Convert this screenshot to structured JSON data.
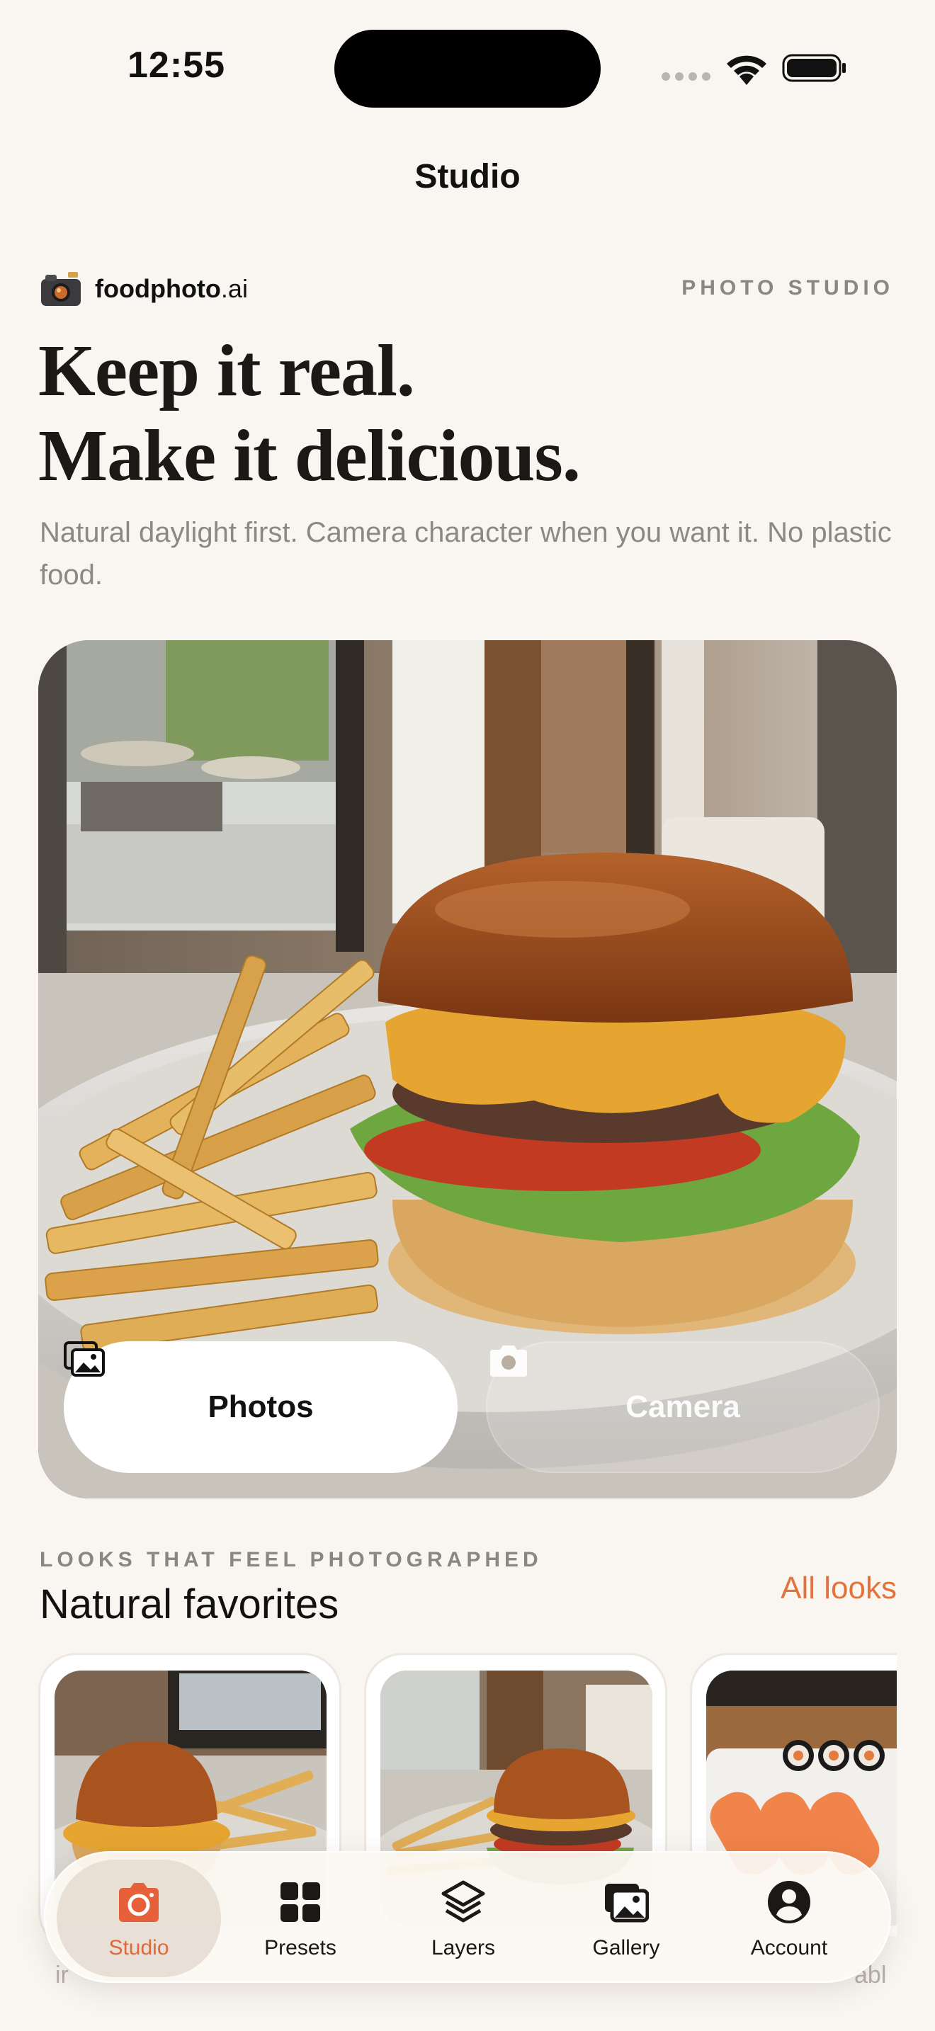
{
  "status_bar": {
    "time": "12:55"
  },
  "nav": {
    "title": "Studio"
  },
  "brand": {
    "name": "foodphoto",
    "name_suffix": ".ai",
    "kicker": "PHOTO STUDIO"
  },
  "hero": {
    "headline_line1": "Keep it real.",
    "headline_line2": "Make it delicious.",
    "subtitle": "Natural daylight first. Camera character when you want it. No plastic food.",
    "photos_button": "Photos",
    "camera_button": "Camera"
  },
  "looks": {
    "kicker": "LOOKS THAT FEEL PHOTOGRAPHED",
    "title": "Natural favorites",
    "all_link": "All looks",
    "peek_left": "ir",
    "peek_right": "abl"
  },
  "tabs": [
    {
      "label": "Studio",
      "icon": "camera-icon",
      "active": true
    },
    {
      "label": "Presets",
      "icon": "grid-icon",
      "active": false
    },
    {
      "label": "Layers",
      "icon": "layers-icon",
      "active": false
    },
    {
      "label": "Gallery",
      "icon": "gallery-icon",
      "active": false
    },
    {
      "label": "Account",
      "icon": "account-icon",
      "active": false
    }
  ],
  "colors": {
    "accent": "#e2733d",
    "background": "#f9f6f1",
    "muted": "#8a8680"
  }
}
